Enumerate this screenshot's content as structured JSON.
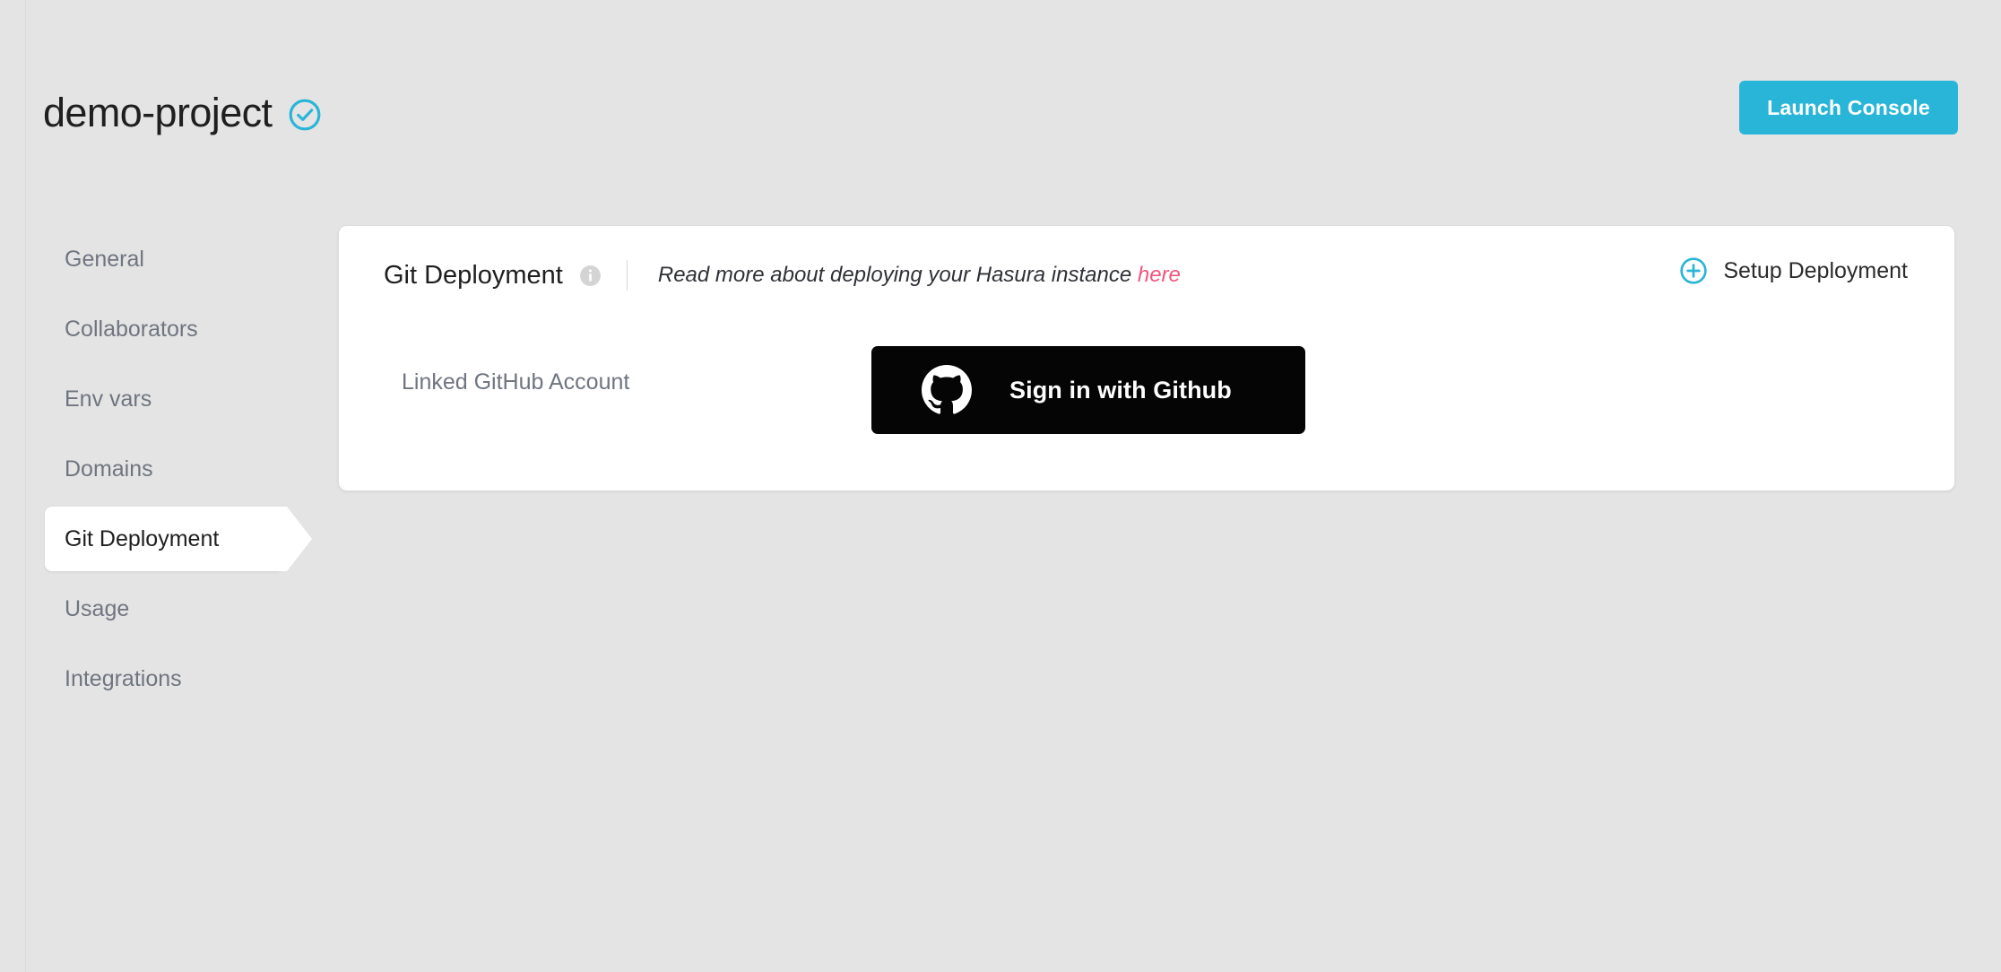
{
  "header": {
    "project_name": "demo-project",
    "status_icon": "check-circle-icon",
    "status_icon_color": "#29b5d8",
    "launch_console_label": "Launch Console",
    "launch_console_color": "#29b5d8"
  },
  "sidebar": {
    "items": [
      {
        "label": "General",
        "active": false
      },
      {
        "label": "Collaborators",
        "active": false
      },
      {
        "label": "Env vars",
        "active": false
      },
      {
        "label": "Domains",
        "active": false
      },
      {
        "label": "Git Deployment",
        "active": true
      },
      {
        "label": "Usage",
        "active": false
      },
      {
        "label": "Integrations",
        "active": false
      }
    ]
  },
  "card": {
    "title": "Git Deployment",
    "info_icon": "info-circle-icon",
    "subtitle_text": "Read more about deploying your Hasura instance ",
    "subtitle_link_label": "here",
    "subtitle_link_color": "#f2567d",
    "setup_deployment_label": "Setup Deployment",
    "setup_deployment_icon": "plus-circle-icon",
    "setup_deployment_icon_color": "#29b5d8",
    "linked_account_label": "Linked GitHub Account",
    "github_signin_label": "Sign in with Github",
    "github_icon": "github-mark-icon",
    "github_button_color": "#050505"
  }
}
